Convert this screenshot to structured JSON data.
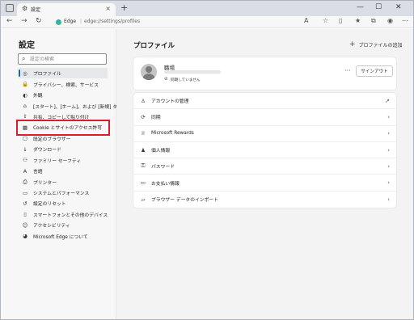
{
  "browser": {
    "tab_title": "設定",
    "tab_icon": "gear-icon",
    "omnibox_app": "Edge",
    "omnibox_separator": "|",
    "url": "edge://settings/profiles"
  },
  "sidebar": {
    "title": "設定",
    "search_placeholder": "設定の検索",
    "items": [
      {
        "icon": "profile-icon",
        "label": "プロファイル",
        "active": true
      },
      {
        "icon": "lock-icon",
        "label": "プライバシー、検索、サービス"
      },
      {
        "icon": "appearance-icon",
        "label": "外観"
      },
      {
        "icon": "start-home-icon",
        "label": "[スタート]、[ホーム]、および [新規] タブ"
      },
      {
        "icon": "share-icon",
        "label": "共有、コピーして貼り付け"
      },
      {
        "icon": "cookie-icon",
        "label": "Cookie とサイトのアクセス許可",
        "highlighted": true
      },
      {
        "icon": "default-browser-icon",
        "label": "既定のブラウザー"
      },
      {
        "icon": "download-icon",
        "label": "ダウンロード"
      },
      {
        "icon": "family-icon",
        "label": "ファミリー セーフティ"
      },
      {
        "icon": "language-icon",
        "label": "言語"
      },
      {
        "icon": "printer-icon",
        "label": "プリンター"
      },
      {
        "icon": "system-icon",
        "label": "システムとパフォーマンス"
      },
      {
        "icon": "reset-icon",
        "label": "設定のリセット"
      },
      {
        "icon": "phone-icon",
        "label": "スマートフォンとその他のデバイス"
      },
      {
        "icon": "accessibility-icon",
        "label": "アクセシビリティ"
      },
      {
        "icon": "edge-icon",
        "label": "Microsoft Edge について"
      }
    ]
  },
  "main": {
    "title": "プロファイル",
    "add_profile": "プロファイルの追加",
    "profile": {
      "name": "職場",
      "sync_status": "同期していません",
      "sign_in": "サインアウト",
      "more": "···"
    },
    "rows": [
      {
        "icon": "person-icon",
        "label": "アカウントの管理",
        "end": "external-link-icon"
      },
      {
        "icon": "sync-icon",
        "label": "同期",
        "end": "chevron-right-icon"
      },
      {
        "icon": "rewards-icon",
        "label": "Microsoft Rewards",
        "end": "chevron-right-icon"
      },
      {
        "icon": "person-info-icon",
        "label": "個人情報",
        "end": "chevron-right-icon"
      },
      {
        "icon": "key-icon",
        "label": "パスワード",
        "end": "chevron-right-icon"
      },
      {
        "icon": "card-icon",
        "label": "お支払い情報",
        "end": "chevron-right-icon"
      },
      {
        "icon": "folder-import-icon",
        "label": "ブラウザー データのインポート",
        "end": "chevron-right-icon"
      }
    ]
  },
  "colors": {
    "accent": "#0f6cbd",
    "highlight_box": "#d3202b",
    "sidebar_bg": "#f7f7f7",
    "main_bg": "#f3f3f3"
  }
}
